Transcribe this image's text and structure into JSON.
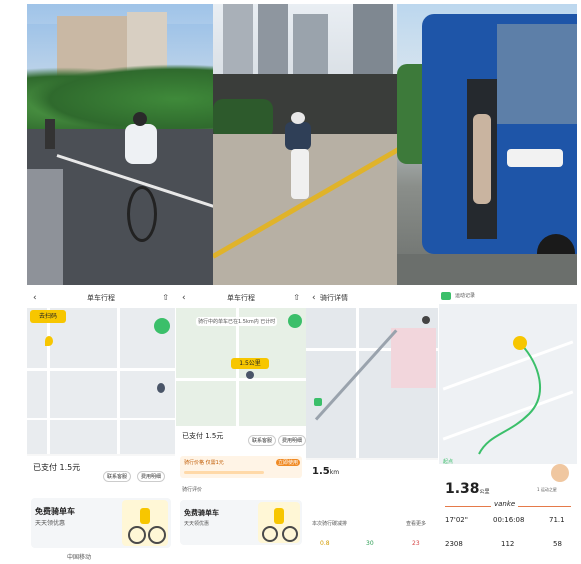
{
  "phones": {
    "p1": {
      "title": "单车行程",
      "badge": "去扫码",
      "paid": "已支付 1.5元",
      "btn_a": "联系客服",
      "btn_b": "费用明细",
      "promo_title": "免费骑单车",
      "promo_sub": "天天领优惠",
      "footer": "中国移动"
    },
    "p2": {
      "title": "单车行程",
      "banner": "骑行中的单车已在1.5km内 已计时",
      "badge": "1.5公里",
      "paid": "已支付 1.5元",
      "btn_a": "联系客服",
      "btn_b": "费用明细",
      "row1": "骑行价格 仅需1元",
      "row1_tag": "立即使用",
      "row2": "骑行评价",
      "promo_title": "免费骑单车",
      "promo_sub": "天天领优惠"
    },
    "p3": {
      "title": "骑行详情",
      "distance": "1.5",
      "unit": "km",
      "row": "本次骑行碳减排",
      "row_tag": "查看更多",
      "stat1": "0.8",
      "stat2": "30",
      "stat3": "23"
    },
    "p4": {
      "title": "运动记录",
      "start_label": "起点",
      "distance": "1.38",
      "unit": "公里",
      "brand": "vanke",
      "user": "1 运动之星",
      "m1": "17'02\"",
      "m2": "00:16:08",
      "m3": "71.1",
      "m4": "2308",
      "m5": "112",
      "m6": "58"
    }
  }
}
